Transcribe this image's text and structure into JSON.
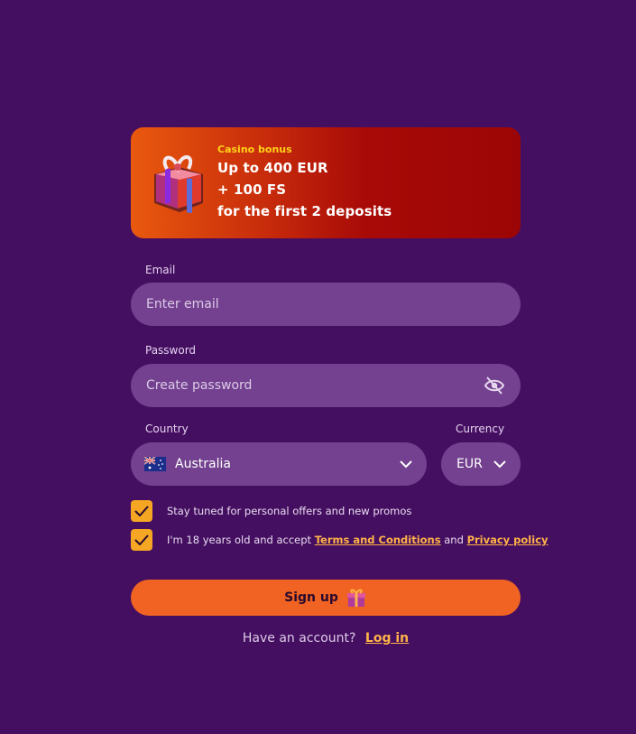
{
  "bonus": {
    "tag": "Casino bonus",
    "line1": "Up to 400 EUR",
    "line2": "+ 100 FS",
    "line3": "for the first 2 deposits",
    "icon": "gift-box-icon"
  },
  "email": {
    "label": "Email",
    "placeholder": "Enter email",
    "value": ""
  },
  "password": {
    "label": "Password",
    "placeholder": "Create password",
    "value": "",
    "toggle_icon": "eye-slash-icon"
  },
  "country": {
    "label": "Country",
    "value": "Australia",
    "flag_icon": "australia-flag-icon"
  },
  "currency": {
    "label": "Currency",
    "value": "EUR"
  },
  "checkboxes": {
    "promos": {
      "text": "Stay tuned for personal offers and new promos",
      "checked": true
    },
    "age": {
      "text_before": "I'm 18 years old and accept ",
      "terms_link": "Terms and Conditions",
      "text_mid": " and ",
      "privacy_link": "Privacy policy",
      "checked": true
    }
  },
  "signup": {
    "label": "Sign up",
    "icon": "gift-icon"
  },
  "login": {
    "prompt": "Have an account?",
    "link": "Log in"
  },
  "colors": {
    "background": "#450f61",
    "field": "#73418f",
    "accent_orange": "#f06322",
    "checkbox": "#f5a623",
    "link": "#ffb347",
    "bonus_tag": "#ffd21a"
  }
}
